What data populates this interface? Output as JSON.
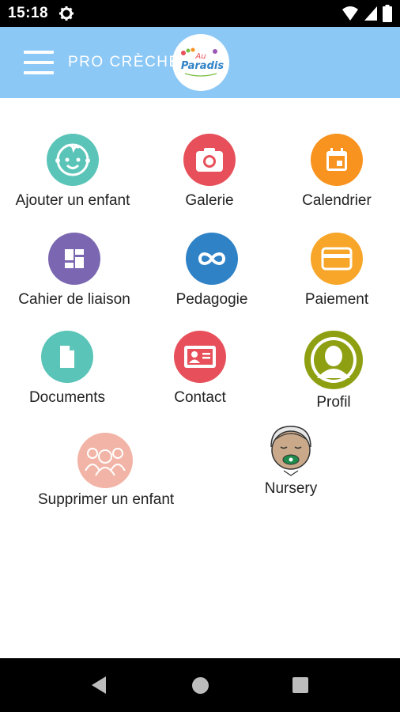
{
  "status_bar": {
    "time": "15:18"
  },
  "app_bar": {
    "title": "PRO CRÈCHE",
    "logo_text": "Au Paradis"
  },
  "menu": [
    {
      "label": "Ajouter un enfant",
      "icon": "baby-face-icon",
      "color": "#5bc4b8"
    },
    {
      "label": "Galerie",
      "icon": "camera-icon",
      "color": "#e7505a"
    },
    {
      "label": "Calendrier",
      "icon": "calendar-icon",
      "color": "#f7931e"
    },
    {
      "label": "Cahier de liaison",
      "icon": "dashboard-icon",
      "color": "#7b67b1"
    },
    {
      "label": "Pedagogie",
      "icon": "infinity-icon",
      "color": "#2f82c6"
    },
    {
      "label": "Paiement",
      "icon": "credit-card-icon",
      "color": "#f7a62a"
    },
    {
      "label": "Documents",
      "icon": "document-icon",
      "color": "#5bc4b8"
    },
    {
      "label": "Contact",
      "icon": "contact-card-icon",
      "color": "#e7505a"
    },
    {
      "label": "Profil",
      "icon": "profile-icon",
      "color": "#8ea012"
    },
    {
      "label": "Supprimer un enfant",
      "icon": "children-group-icon",
      "color": "#f2b4a6"
    },
    {
      "label": "Nursery",
      "icon": "baby-pacifier-icon",
      "color": "#c9a98a"
    }
  ]
}
